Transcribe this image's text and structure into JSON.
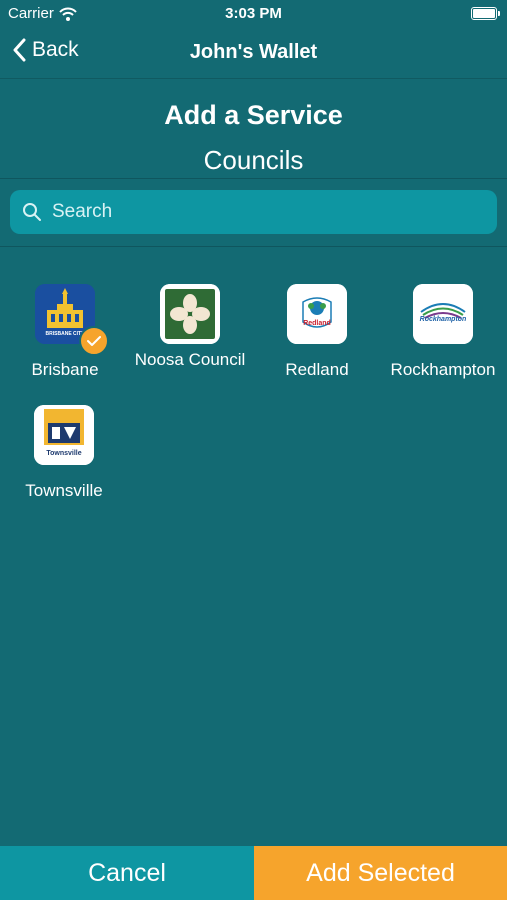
{
  "status_bar": {
    "carrier": "Carrier",
    "time": "3:03 PM"
  },
  "nav": {
    "back_label": "Back",
    "title": "John's Wallet"
  },
  "heading": {
    "title": "Add a Service",
    "subtitle": "Councils"
  },
  "search": {
    "placeholder": "Search",
    "value": ""
  },
  "services": [
    {
      "name": "Brisbane",
      "selected": true,
      "icon": "brisbane-city-logo",
      "logo_text": "BRISBANE CITY"
    },
    {
      "name": "Noosa Council",
      "selected": false,
      "icon": "noosa-council-logo"
    },
    {
      "name": "Redland",
      "selected": false,
      "icon": "redland-city-council-logo",
      "logo_text": "Redland"
    },
    {
      "name": "Rockhampton",
      "selected": false,
      "icon": "rockhampton-regional-council-logo",
      "logo_text": "Rockhampton"
    },
    {
      "name": "Townsville",
      "selected": false,
      "icon": "city-of-townsville-logo",
      "logo_text": "Townsville"
    }
  ],
  "actions": {
    "cancel_label": "Cancel",
    "add_label": "Add Selected"
  },
  "colors": {
    "background": "#136a73",
    "search_field": "#0e96a2",
    "cancel_button": "#0e96a2",
    "accent": "#f6a42c"
  }
}
